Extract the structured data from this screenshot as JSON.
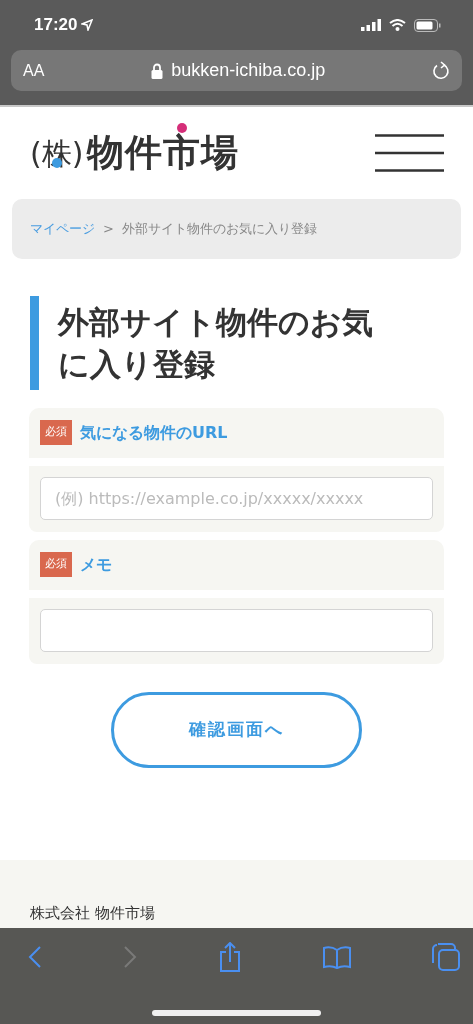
{
  "status_bar": {
    "time": "17:20"
  },
  "address_bar": {
    "text_size": "AA",
    "url": "bukken-ichiba.co.jp"
  },
  "header": {
    "logo_prefix": "(株)",
    "logo_name": "物件市場"
  },
  "breadcrumb": [
    {
      "label": "マイページ",
      "link": true
    },
    {
      "label": "外部サイト物件のお気に入り登録",
      "link": false
    }
  ],
  "breadcrumb_separator": ">",
  "title": "外部サイト物件のお気に入り登録",
  "fields": [
    {
      "badge": "必須",
      "label": "気になる物件のURL",
      "placeholder": "(例) https://example.co.jp/xxxxx/xxxxx"
    },
    {
      "badge": "必須",
      "label": "メモ"
    }
  ],
  "submit_button": "確認画面へ",
  "footer": {
    "company": "株式会社 物件市場"
  },
  "toolbar": {
    "back_disabled": false,
    "forward_disabled": true
  }
}
